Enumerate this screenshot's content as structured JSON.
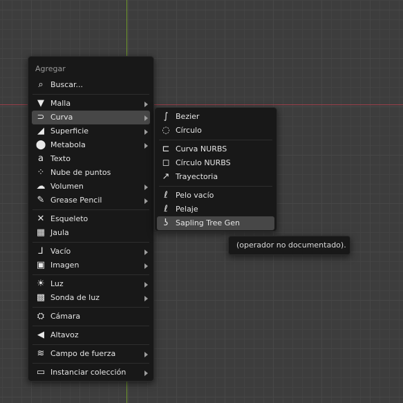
{
  "viewport": {
    "grid_color": "#474747",
    "x_axis_color": "#9a3f4a",
    "y_axis_color": "#6f9a2a"
  },
  "menu": {
    "title": "Agregar",
    "search": {
      "label": "Buscar...",
      "icon": "search-icon"
    },
    "groups": [
      [
        {
          "label": "Malla",
          "icon": "mesh-icon",
          "submenu": true
        },
        {
          "label": "Curva",
          "icon": "curve-icon",
          "submenu": true,
          "active": true
        },
        {
          "label": "Superficie",
          "icon": "surface-icon",
          "submenu": true
        },
        {
          "label": "Metabola",
          "icon": "metaball-icon",
          "submenu": true
        },
        {
          "label": "Texto",
          "icon": "text-icon",
          "submenu": false
        },
        {
          "label": "Nube de puntos",
          "icon": "pointcloud-icon",
          "submenu": false
        },
        {
          "label": "Volumen",
          "icon": "volume-icon",
          "submenu": true
        },
        {
          "label": "Grease Pencil",
          "icon": "grease-pencil-icon",
          "submenu": true
        }
      ],
      [
        {
          "label": "Esqueleto",
          "icon": "armature-icon",
          "submenu": false
        },
        {
          "label": "Jaula",
          "icon": "lattice-icon",
          "submenu": false
        }
      ],
      [
        {
          "label": "Vacío",
          "icon": "empty-icon",
          "submenu": true
        },
        {
          "label": "Imagen",
          "icon": "image-icon",
          "submenu": true
        }
      ],
      [
        {
          "label": "Luz",
          "icon": "light-icon",
          "submenu": true
        },
        {
          "label": "Sonda de luz",
          "icon": "light-probe-icon",
          "submenu": true
        }
      ],
      [
        {
          "label": "Cámara",
          "icon": "camera-icon",
          "submenu": false
        }
      ],
      [
        {
          "label": "Altavoz",
          "icon": "speaker-icon",
          "submenu": false
        }
      ],
      [
        {
          "label": "Campo de fuerza",
          "icon": "force-field-icon",
          "submenu": true
        }
      ],
      [
        {
          "label": "Instanciar colección",
          "icon": "collection-icon",
          "submenu": true
        }
      ]
    ]
  },
  "submenu": {
    "groups": [
      [
        {
          "label": "Bezier",
          "icon": "bezier-icon"
        },
        {
          "label": "Círculo",
          "icon": "bezier-circle-icon"
        }
      ],
      [
        {
          "label": "Curva NURBS",
          "icon": "nurbs-curve-icon"
        },
        {
          "label": "Círculo NURBS",
          "icon": "nurbs-circle-icon"
        },
        {
          "label": "Trayectoria",
          "icon": "path-icon"
        }
      ],
      [
        {
          "label": "Pelo vacío",
          "icon": "empty-hair-icon"
        },
        {
          "label": "Pelaje",
          "icon": "fur-icon"
        },
        {
          "label": "Sapling Tree Gen",
          "icon": "tree-curve-icon",
          "active": true
        }
      ]
    ]
  },
  "tooltip": {
    "text": "(operador no documentado)."
  }
}
